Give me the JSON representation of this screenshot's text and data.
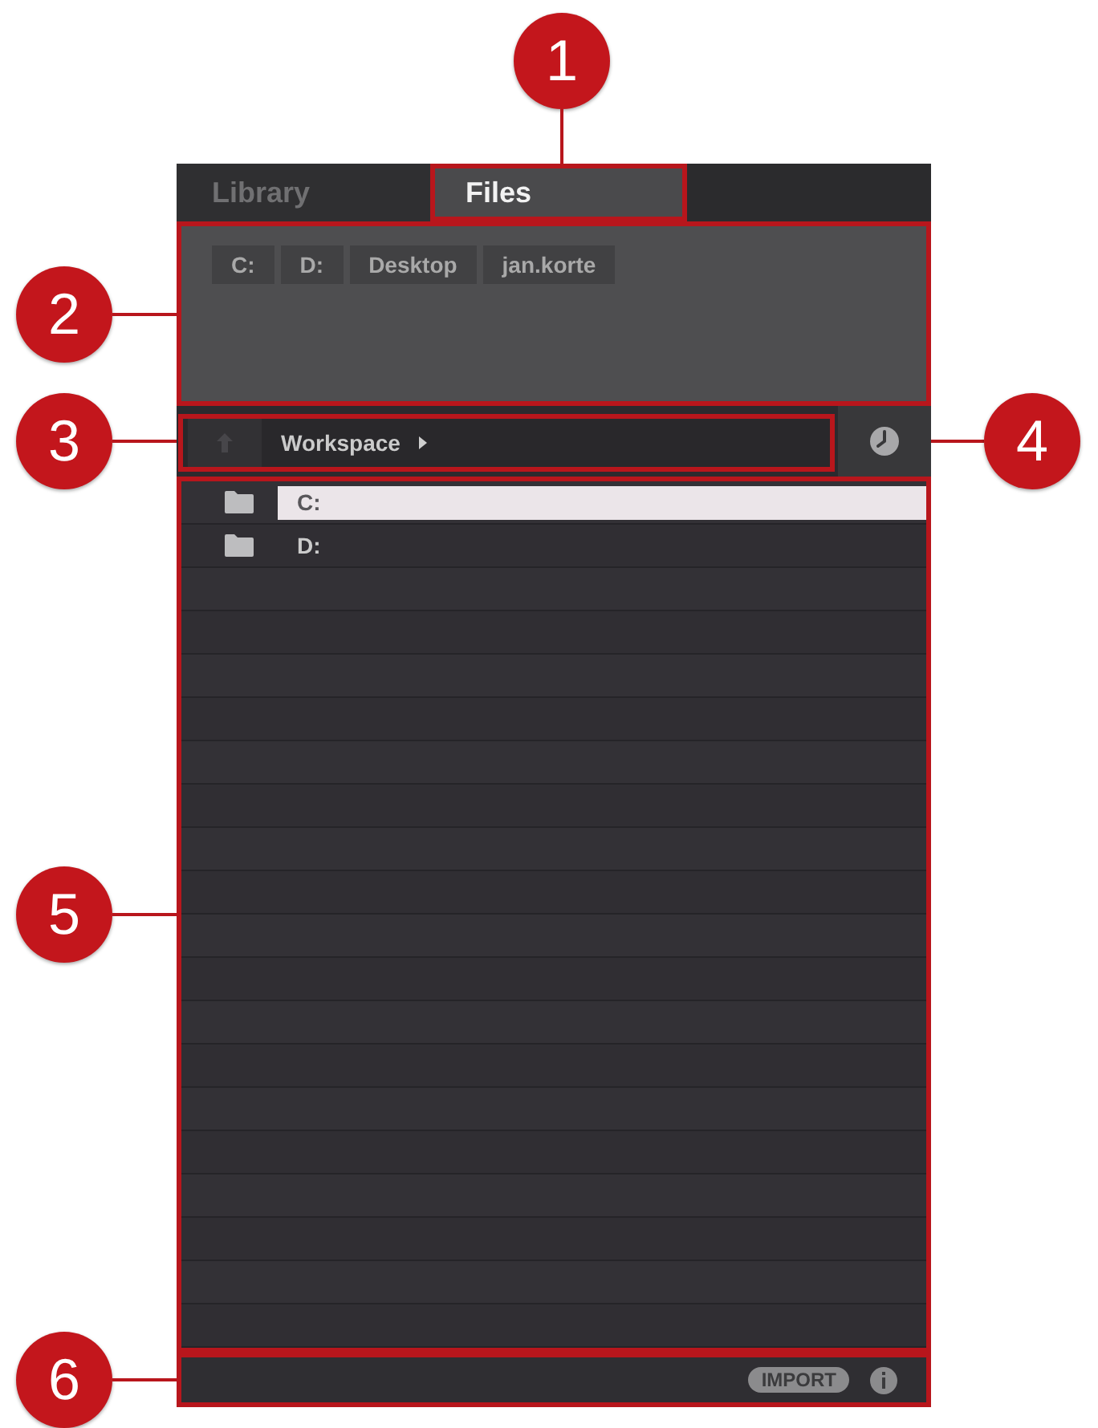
{
  "tabs": {
    "callout": "1",
    "items": [
      {
        "label": "Library",
        "selected": false
      },
      {
        "label": "Files",
        "selected": true
      }
    ]
  },
  "favorites": {
    "callout": "2",
    "items": [
      "C:",
      "D:",
      "Desktop",
      "jan.korte"
    ]
  },
  "path_bar": {
    "callout": "3",
    "path": "Workspace"
  },
  "history_button": {
    "callout": "4"
  },
  "file_list": {
    "callout": "5",
    "rows": [
      {
        "name": "C:",
        "selected": true
      },
      {
        "name": "D:",
        "selected": false
      }
    ]
  },
  "footer": {
    "callout": "6",
    "button": "IMPORT"
  }
}
